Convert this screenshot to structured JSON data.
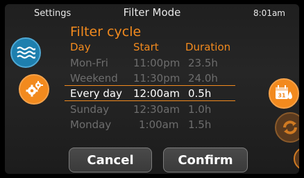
{
  "status_bar": {
    "left": "Settings",
    "title": "Filter Mode",
    "time": "8:01am"
  },
  "section_title": "Filter cycle",
  "columns": {
    "day": "Day",
    "start": "Start",
    "duration": "Duration"
  },
  "rows": [
    {
      "day": "Mon-Fri",
      "start": "11:00pm",
      "duration": "23.5h"
    },
    {
      "day": "Weekend",
      "start": "11:30pm",
      "duration": "24.0h"
    },
    {
      "day": "Every day",
      "start": "12:00am",
      "duration": "0.5h"
    },
    {
      "day": "Sunday",
      "start": "12:30am",
      "duration": "1.0h"
    },
    {
      "day": "Monday",
      "start": "1:00am",
      "duration": "1.5h"
    }
  ],
  "calendar_icon_day": "31",
  "buttons": {
    "cancel": "Cancel",
    "confirm": "Confirm"
  },
  "icons": {
    "water": "water-waves-icon",
    "settings": "settings-gears-icon",
    "calendar": "calendar-water-icon",
    "cycle": "cycle-arrows-icon",
    "partial": "side-tool-icon"
  },
  "colors": {
    "accent": "#f28a1e",
    "water_blue": "#1e7fae",
    "dim_text": "#6d6d6d"
  }
}
